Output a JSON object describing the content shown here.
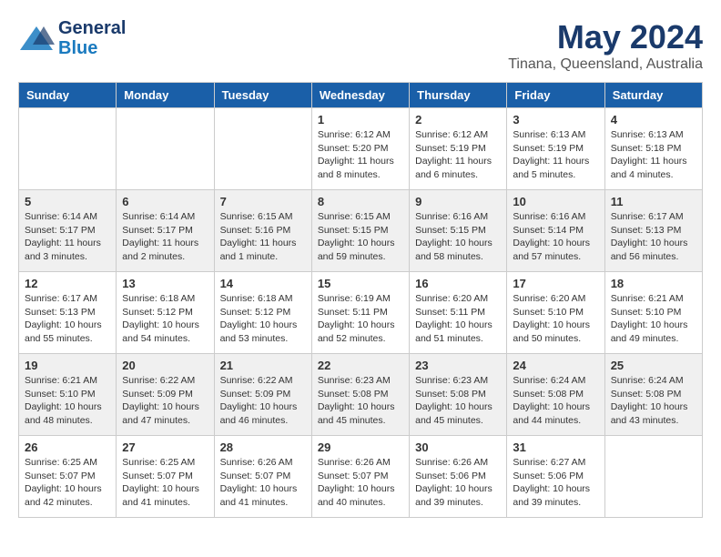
{
  "header": {
    "logo_line1": "General",
    "logo_line2": "Blue",
    "main_title": "May 2024",
    "sub_title": "Tinana, Queensland, Australia"
  },
  "days_of_week": [
    "Sunday",
    "Monday",
    "Tuesday",
    "Wednesday",
    "Thursday",
    "Friday",
    "Saturday"
  ],
  "weeks": [
    [
      {
        "day": "",
        "info": ""
      },
      {
        "day": "",
        "info": ""
      },
      {
        "day": "",
        "info": ""
      },
      {
        "day": "1",
        "info": "Sunrise: 6:12 AM\nSunset: 5:20 PM\nDaylight: 11 hours\nand 8 minutes."
      },
      {
        "day": "2",
        "info": "Sunrise: 6:12 AM\nSunset: 5:19 PM\nDaylight: 11 hours\nand 6 minutes."
      },
      {
        "day": "3",
        "info": "Sunrise: 6:13 AM\nSunset: 5:19 PM\nDaylight: 11 hours\nand 5 minutes."
      },
      {
        "day": "4",
        "info": "Sunrise: 6:13 AM\nSunset: 5:18 PM\nDaylight: 11 hours\nand 4 minutes."
      }
    ],
    [
      {
        "day": "5",
        "info": "Sunrise: 6:14 AM\nSunset: 5:17 PM\nDaylight: 11 hours\nand 3 minutes."
      },
      {
        "day": "6",
        "info": "Sunrise: 6:14 AM\nSunset: 5:17 PM\nDaylight: 11 hours\nand 2 minutes."
      },
      {
        "day": "7",
        "info": "Sunrise: 6:15 AM\nSunset: 5:16 PM\nDaylight: 11 hours\nand 1 minute."
      },
      {
        "day": "8",
        "info": "Sunrise: 6:15 AM\nSunset: 5:15 PM\nDaylight: 10 hours\nand 59 minutes."
      },
      {
        "day": "9",
        "info": "Sunrise: 6:16 AM\nSunset: 5:15 PM\nDaylight: 10 hours\nand 58 minutes."
      },
      {
        "day": "10",
        "info": "Sunrise: 6:16 AM\nSunset: 5:14 PM\nDaylight: 10 hours\nand 57 minutes."
      },
      {
        "day": "11",
        "info": "Sunrise: 6:17 AM\nSunset: 5:13 PM\nDaylight: 10 hours\nand 56 minutes."
      }
    ],
    [
      {
        "day": "12",
        "info": "Sunrise: 6:17 AM\nSunset: 5:13 PM\nDaylight: 10 hours\nand 55 minutes."
      },
      {
        "day": "13",
        "info": "Sunrise: 6:18 AM\nSunset: 5:12 PM\nDaylight: 10 hours\nand 54 minutes."
      },
      {
        "day": "14",
        "info": "Sunrise: 6:18 AM\nSunset: 5:12 PM\nDaylight: 10 hours\nand 53 minutes."
      },
      {
        "day": "15",
        "info": "Sunrise: 6:19 AM\nSunset: 5:11 PM\nDaylight: 10 hours\nand 52 minutes."
      },
      {
        "day": "16",
        "info": "Sunrise: 6:20 AM\nSunset: 5:11 PM\nDaylight: 10 hours\nand 51 minutes."
      },
      {
        "day": "17",
        "info": "Sunrise: 6:20 AM\nSunset: 5:10 PM\nDaylight: 10 hours\nand 50 minutes."
      },
      {
        "day": "18",
        "info": "Sunrise: 6:21 AM\nSunset: 5:10 PM\nDaylight: 10 hours\nand 49 minutes."
      }
    ],
    [
      {
        "day": "19",
        "info": "Sunrise: 6:21 AM\nSunset: 5:10 PM\nDaylight: 10 hours\nand 48 minutes."
      },
      {
        "day": "20",
        "info": "Sunrise: 6:22 AM\nSunset: 5:09 PM\nDaylight: 10 hours\nand 47 minutes."
      },
      {
        "day": "21",
        "info": "Sunrise: 6:22 AM\nSunset: 5:09 PM\nDaylight: 10 hours\nand 46 minutes."
      },
      {
        "day": "22",
        "info": "Sunrise: 6:23 AM\nSunset: 5:08 PM\nDaylight: 10 hours\nand 45 minutes."
      },
      {
        "day": "23",
        "info": "Sunrise: 6:23 AM\nSunset: 5:08 PM\nDaylight: 10 hours\nand 45 minutes."
      },
      {
        "day": "24",
        "info": "Sunrise: 6:24 AM\nSunset: 5:08 PM\nDaylight: 10 hours\nand 44 minutes."
      },
      {
        "day": "25",
        "info": "Sunrise: 6:24 AM\nSunset: 5:08 PM\nDaylight: 10 hours\nand 43 minutes."
      }
    ],
    [
      {
        "day": "26",
        "info": "Sunrise: 6:25 AM\nSunset: 5:07 PM\nDaylight: 10 hours\nand 42 minutes."
      },
      {
        "day": "27",
        "info": "Sunrise: 6:25 AM\nSunset: 5:07 PM\nDaylight: 10 hours\nand 41 minutes."
      },
      {
        "day": "28",
        "info": "Sunrise: 6:26 AM\nSunset: 5:07 PM\nDaylight: 10 hours\nand 41 minutes."
      },
      {
        "day": "29",
        "info": "Sunrise: 6:26 AM\nSunset: 5:07 PM\nDaylight: 10 hours\nand 40 minutes."
      },
      {
        "day": "30",
        "info": "Sunrise: 6:26 AM\nSunset: 5:06 PM\nDaylight: 10 hours\nand 39 minutes."
      },
      {
        "day": "31",
        "info": "Sunrise: 6:27 AM\nSunset: 5:06 PM\nDaylight: 10 hours\nand 39 minutes."
      },
      {
        "day": "",
        "info": ""
      }
    ]
  ]
}
